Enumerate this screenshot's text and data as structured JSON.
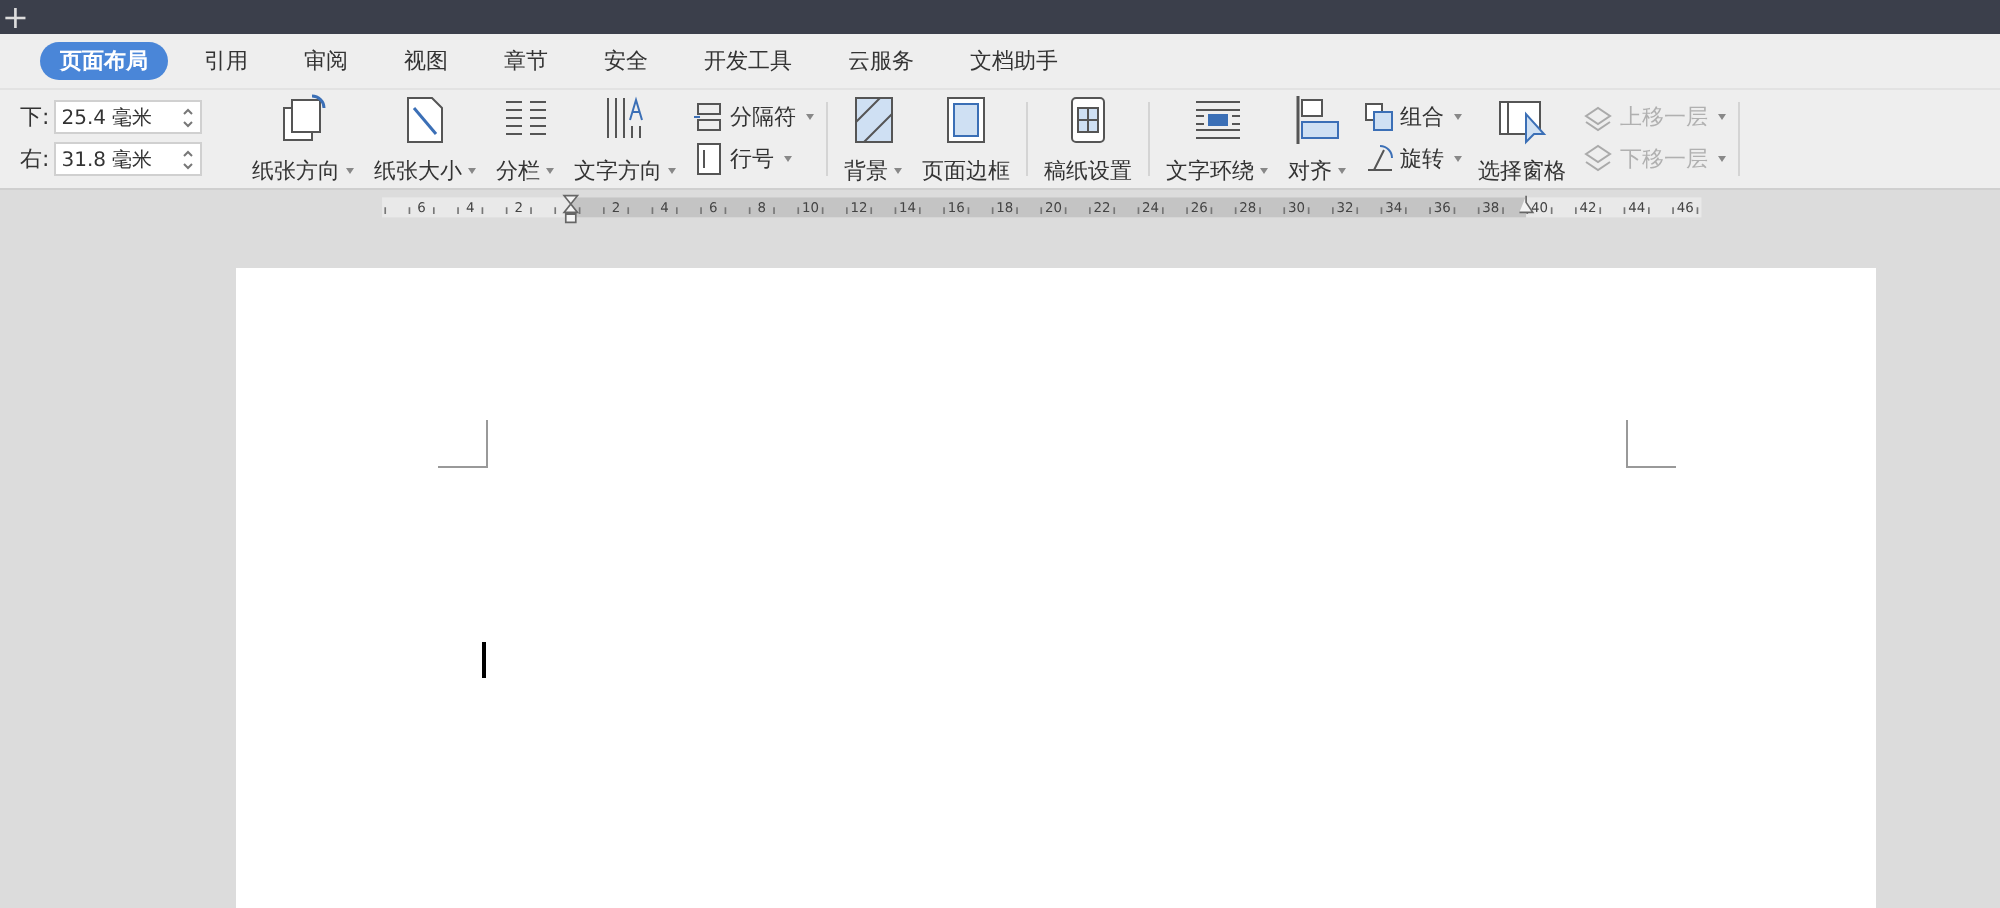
{
  "title_bar": {
    "new_tab": "+"
  },
  "tabs": [
    {
      "label": "页面布局",
      "selected": true
    },
    {
      "label": "引用",
      "selected": false
    },
    {
      "label": "审阅",
      "selected": false
    },
    {
      "label": "视图",
      "selected": false
    },
    {
      "label": "章节",
      "selected": false
    },
    {
      "label": "安全",
      "selected": false
    },
    {
      "label": "开发工具",
      "selected": false
    },
    {
      "label": "云服务",
      "selected": false
    },
    {
      "label": "文档助手",
      "selected": false
    }
  ],
  "margins": [
    {
      "label": "下:",
      "value": "25.4 毫米"
    },
    {
      "label": "右:",
      "value": "31.8 毫米"
    }
  ],
  "ribbon_groups": [
    {
      "items": [
        {
          "kind": "large",
          "label": "纸张方向",
          "dropdown": true
        },
        {
          "kind": "large",
          "label": "纸张大小",
          "dropdown": true
        },
        {
          "kind": "large",
          "label": "分栏",
          "dropdown": true
        },
        {
          "kind": "large",
          "label": "文字方向",
          "dropdown": true
        },
        {
          "kind": "stack",
          "buttons": [
            {
              "label": "分隔符",
              "dropdown": true,
              "disabled": false
            },
            {
              "label": "行号",
              "dropdown": true,
              "disabled": false
            }
          ]
        }
      ]
    },
    {
      "items": [
        {
          "kind": "large",
          "label": "背景",
          "dropdown": true
        },
        {
          "kind": "large",
          "label": "页面边框",
          "dropdown": false
        }
      ]
    },
    {
      "items": [
        {
          "kind": "large",
          "label": "稿纸设置",
          "dropdown": false
        }
      ]
    },
    {
      "items": [
        {
          "kind": "large",
          "label": "文字环绕",
          "dropdown": true
        },
        {
          "kind": "large",
          "label": "对齐",
          "dropdown": true
        },
        {
          "kind": "stack",
          "buttons": [
            {
              "label": "组合",
              "dropdown": true,
              "disabled": false
            },
            {
              "label": "旋转",
              "dropdown": true,
              "disabled": false
            }
          ]
        },
        {
          "kind": "large",
          "label": "选择窗格",
          "dropdown": false
        },
        {
          "kind": "stack",
          "buttons": [
            {
              "label": "上移一层",
              "dropdown": true,
              "disabled": true
            },
            {
              "label": "下移一层",
              "dropdown": true,
              "disabled": true
            }
          ]
        }
      ]
    }
  ],
  "ruler": {
    "left_labels": [
      "6",
      "4",
      "2"
    ],
    "right_labels": [
      "2",
      "4",
      "6",
      "8",
      "10",
      "12",
      "14",
      "16",
      "18",
      "20",
      "22",
      "24",
      "26",
      "28",
      "30",
      "32",
      "34",
      "36",
      "38",
      "40",
      "42",
      "44",
      "46"
    ]
  }
}
